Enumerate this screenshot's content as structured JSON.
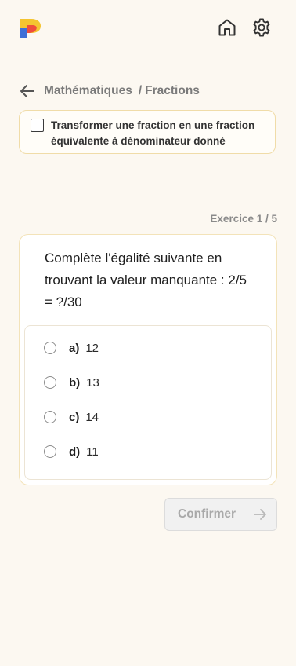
{
  "header": {
    "logo_icon": "app-logo",
    "home_icon": "home-icon",
    "settings_icon": "gear-icon"
  },
  "breadcrumb": {
    "back_icon": "arrow-left-icon",
    "subject": "Mathématiques",
    "separator": "/",
    "topic": "Fractions"
  },
  "objective": {
    "checked": false,
    "label": "Transformer une fraction en une fraction équivalente à dénominateur donné"
  },
  "exercise": {
    "counter": "Exercice 1 / 5",
    "question": "Complète l'égalité suivante en trouvant la valeur manquante : 2/5 = ?/30",
    "options": [
      {
        "letter": "a)",
        "value": "12"
      },
      {
        "letter": "b)",
        "value": "13"
      },
      {
        "letter": "c)",
        "value": "14"
      },
      {
        "letter": "d)",
        "value": "11"
      }
    ]
  },
  "actions": {
    "confirm_label": "Confirmer",
    "confirm_icon": "arrow-right-icon"
  },
  "colors": {
    "background": "#fcf8f1",
    "card_border": "#f3e3b9",
    "logo_yellow": "#f4c430",
    "logo_red": "#ef4c3c",
    "logo_blue": "#3f6fd6",
    "disabled_text": "#a9a9a9"
  }
}
